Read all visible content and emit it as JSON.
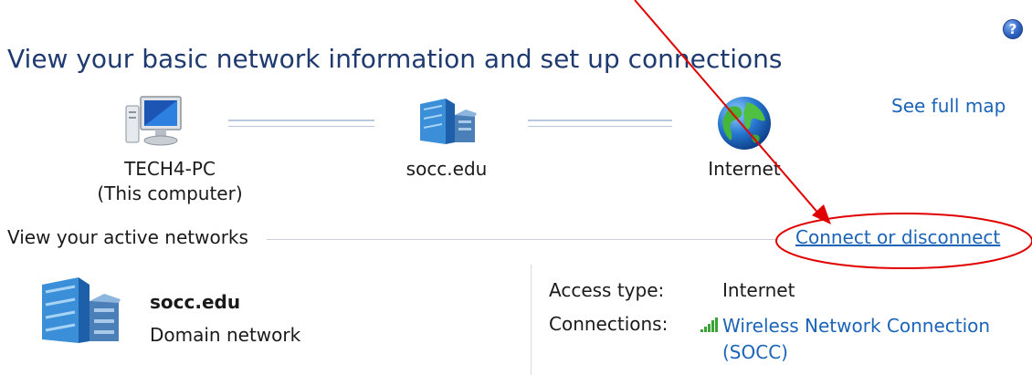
{
  "title": "View your basic network information and set up connections",
  "help_icon": "?",
  "see_full_map": "See full map",
  "map": {
    "computer": {
      "name": "TECH4-PC",
      "sub": "(This computer)",
      "icon": "computer-icon"
    },
    "network": {
      "name": "socc.edu",
      "icon": "network-building-icon"
    },
    "internet": {
      "name": "Internet",
      "icon": "globe-icon"
    }
  },
  "active_networks": {
    "header": "View your active networks",
    "connect_link": "Connect or disconnect",
    "network": {
      "name": "socc.edu",
      "type": "Domain network",
      "icon": "network-building-icon"
    },
    "access_type_label": "Access type:",
    "access_type_value": "Internet",
    "connections_label": "Connections:",
    "connection_name": "Wireless Network Connection (SOCC)",
    "connection_icon": "wireless-signal-icon"
  },
  "annotation_color": "#e00000"
}
